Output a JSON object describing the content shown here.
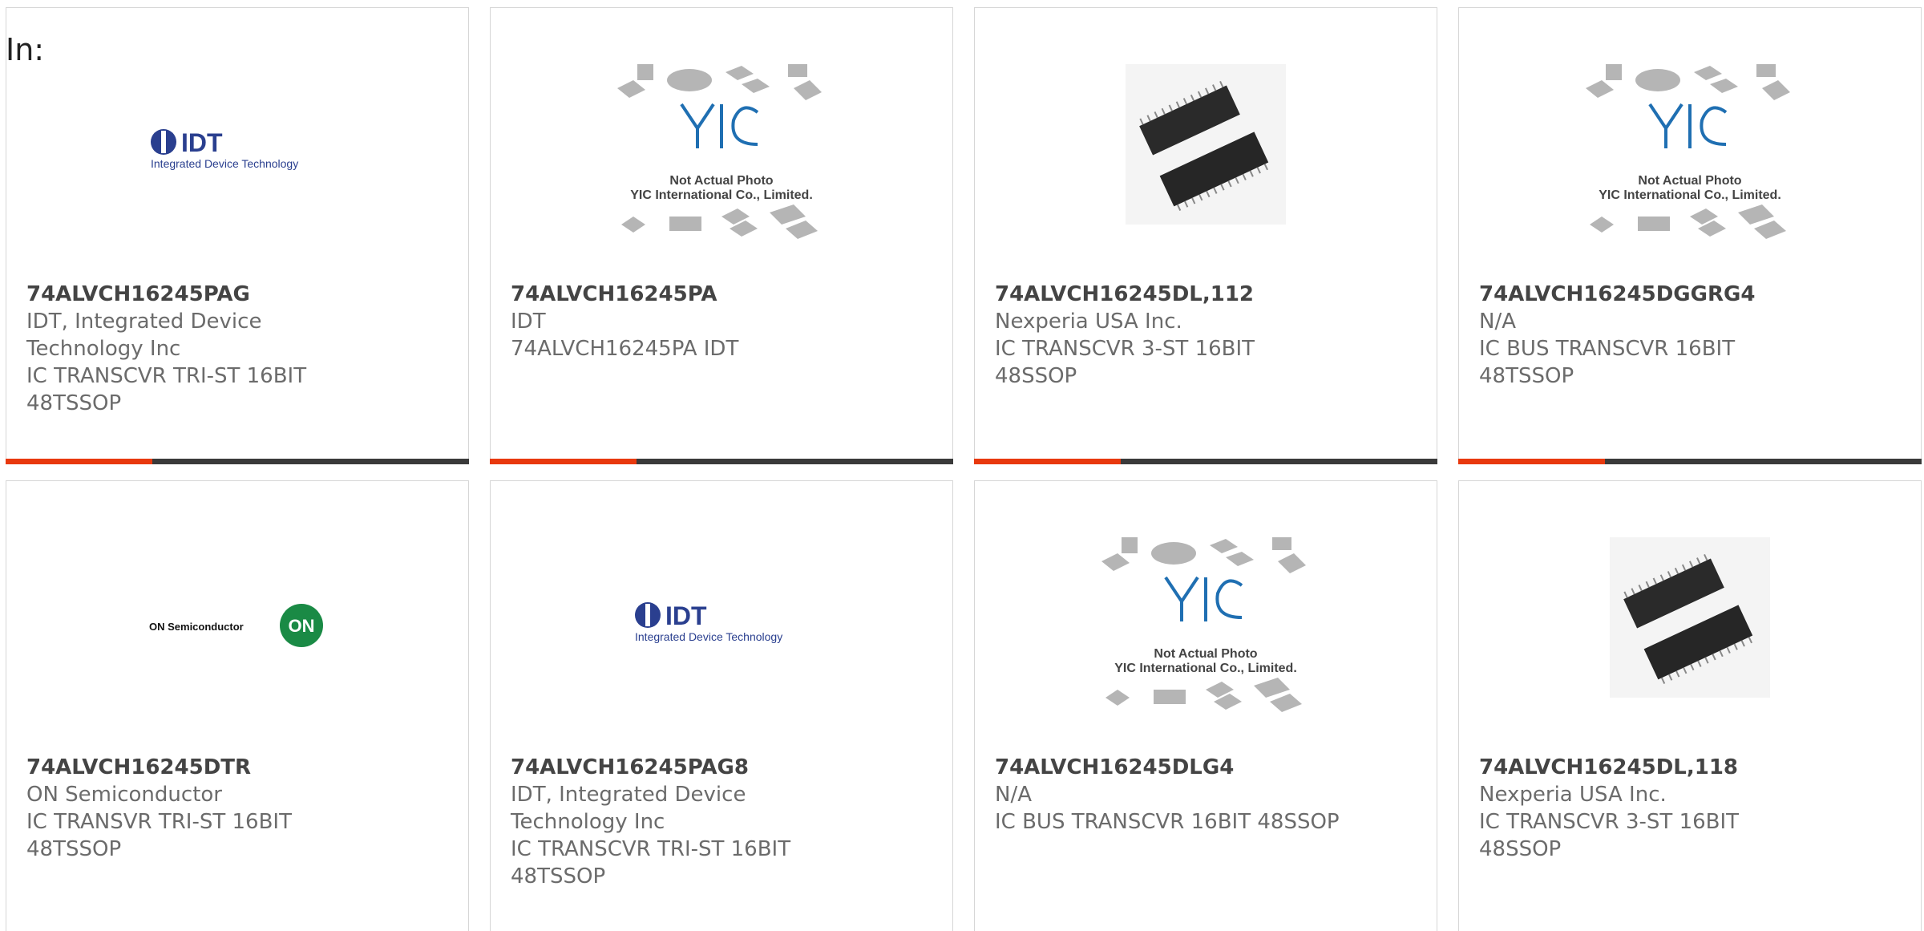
{
  "header": {
    "in_label": "In:"
  },
  "images": {
    "yic_caption_line1": "Not Actual Photo",
    "yic_caption_line2": "YIC International Co., Limited.",
    "idt_logo_text": "IDT",
    "idt_logo_subtext": "Integrated Device Technology",
    "on_logo_text": "ON Semiconductor",
    "on_logo_badge": "ON"
  },
  "colors": {
    "accent": "#e8390e",
    "bar_dark": "#3a3a3a",
    "idt_blue": "#2a3f8f"
  },
  "products": [
    {
      "part": "74ALVCH16245PAG",
      "maker": "IDT, Integrated Device Technology Inc",
      "desc": "IC TRANSCVR TRI-ST 16BIT 48TSSOP",
      "image": "idt-logo"
    },
    {
      "part": "74ALVCH16245PA",
      "maker": "IDT",
      "desc": "74ALVCH16245PA IDT",
      "image": "yic-placeholder"
    },
    {
      "part": "74ALVCH16245DL,112",
      "maker": "Nexperia USA Inc.",
      "desc": "IC TRANSCVR 3-ST 16BIT 48SSOP",
      "image": "chip-photo"
    },
    {
      "part": "74ALVCH16245DGGRG4",
      "maker": "N/A",
      "desc": "IC BUS TRANSCVR 16BIT 48TSSOP",
      "image": "yic-placeholder"
    },
    {
      "part": "74ALVCH16245DTR",
      "maker": "ON Semiconductor",
      "desc": "IC TRANSVR TRI-ST 16BIT 48TSSOP",
      "image": "on-logo"
    },
    {
      "part": "74ALVCH16245PAG8",
      "maker": "IDT, Integrated Device Technology Inc",
      "desc": "IC TRANSCVR TRI-ST 16BIT 48TSSOP",
      "image": "idt-logo"
    },
    {
      "part": "74ALVCH16245DLG4",
      "maker": "N/A",
      "desc": "IC BUS TRANSCVR 16BIT 48SSOP",
      "image": "yic-placeholder"
    },
    {
      "part": "74ALVCH16245DL,118",
      "maker": "Nexperia USA Inc.",
      "desc": "IC TRANSCVR 3-ST 16BIT 48SSOP",
      "image": "chip-photo"
    }
  ]
}
